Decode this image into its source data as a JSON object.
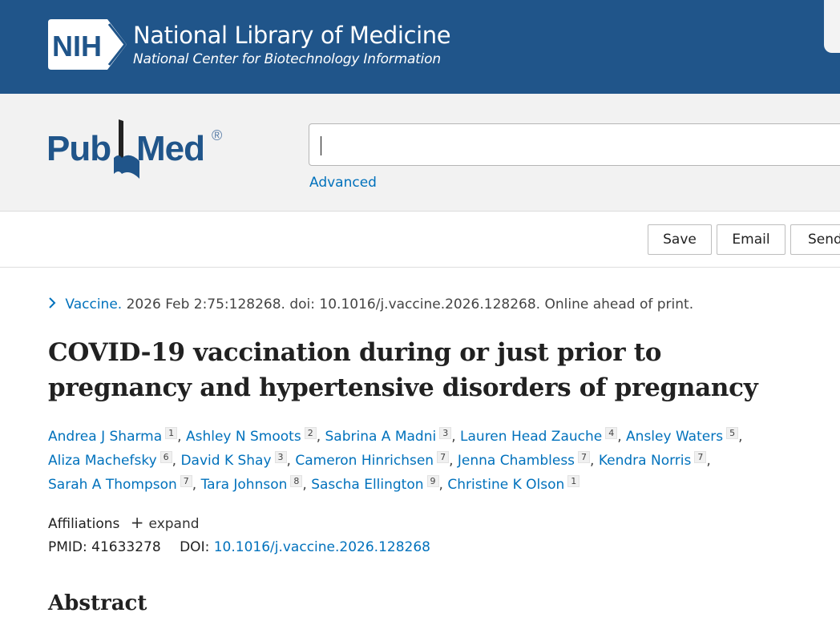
{
  "nlm": {
    "badge": "NIH",
    "title": "National Library of Medicine",
    "subtitle": "National Center for Biotechnology Information"
  },
  "pubmed": {
    "logo_pub": "Pub",
    "logo_med": "Med",
    "logo_reg": "®",
    "search_value": "",
    "advanced_label": "Advanced"
  },
  "actions": {
    "save": "Save",
    "email": "Email",
    "send": "Send"
  },
  "article": {
    "journal": "Vaccine.",
    "citation_rest": " 2026 Feb 2:75:128268. doi: 10.1016/j.vaccine.2026.128268. Online ahead of print.",
    "title": "COVID-19 vaccination during or just prior to pregnancy and hypertensive disorders of pregnancy",
    "authors": [
      {
        "name": "Andrea J Sharma",
        "aff": "1"
      },
      {
        "name": "Ashley N Smoots",
        "aff": "2"
      },
      {
        "name": "Sabrina A Madni",
        "aff": "3"
      },
      {
        "name": "Lauren Head Zauche",
        "aff": "4"
      },
      {
        "name": "Ansley Waters",
        "aff": "5"
      },
      {
        "name": "Aliza Machefsky",
        "aff": "6"
      },
      {
        "name": "David K Shay",
        "aff": "3"
      },
      {
        "name": "Cameron Hinrichsen",
        "aff": "7"
      },
      {
        "name": "Jenna Chambless",
        "aff": "7"
      },
      {
        "name": "Kendra Norris",
        "aff": "7"
      },
      {
        "name": "Sarah A Thompson",
        "aff": "7"
      },
      {
        "name": "Tara Johnson",
        "aff": "8"
      },
      {
        "name": "Sascha Ellington",
        "aff": "9"
      },
      {
        "name": "Christine K Olson",
        "aff": "1"
      }
    ],
    "affiliations_label": "Affiliations",
    "expand_label": "expand",
    "pmid_label": "PMID: 41633278",
    "doi_label": "DOI:",
    "doi_value": "10.1016/j.vaccine.2026.128268",
    "abstract_heading": "Abstract"
  },
  "colors": {
    "banner": "#20558a",
    "link": "#0071bc",
    "search_band": "#f2f2f2"
  }
}
